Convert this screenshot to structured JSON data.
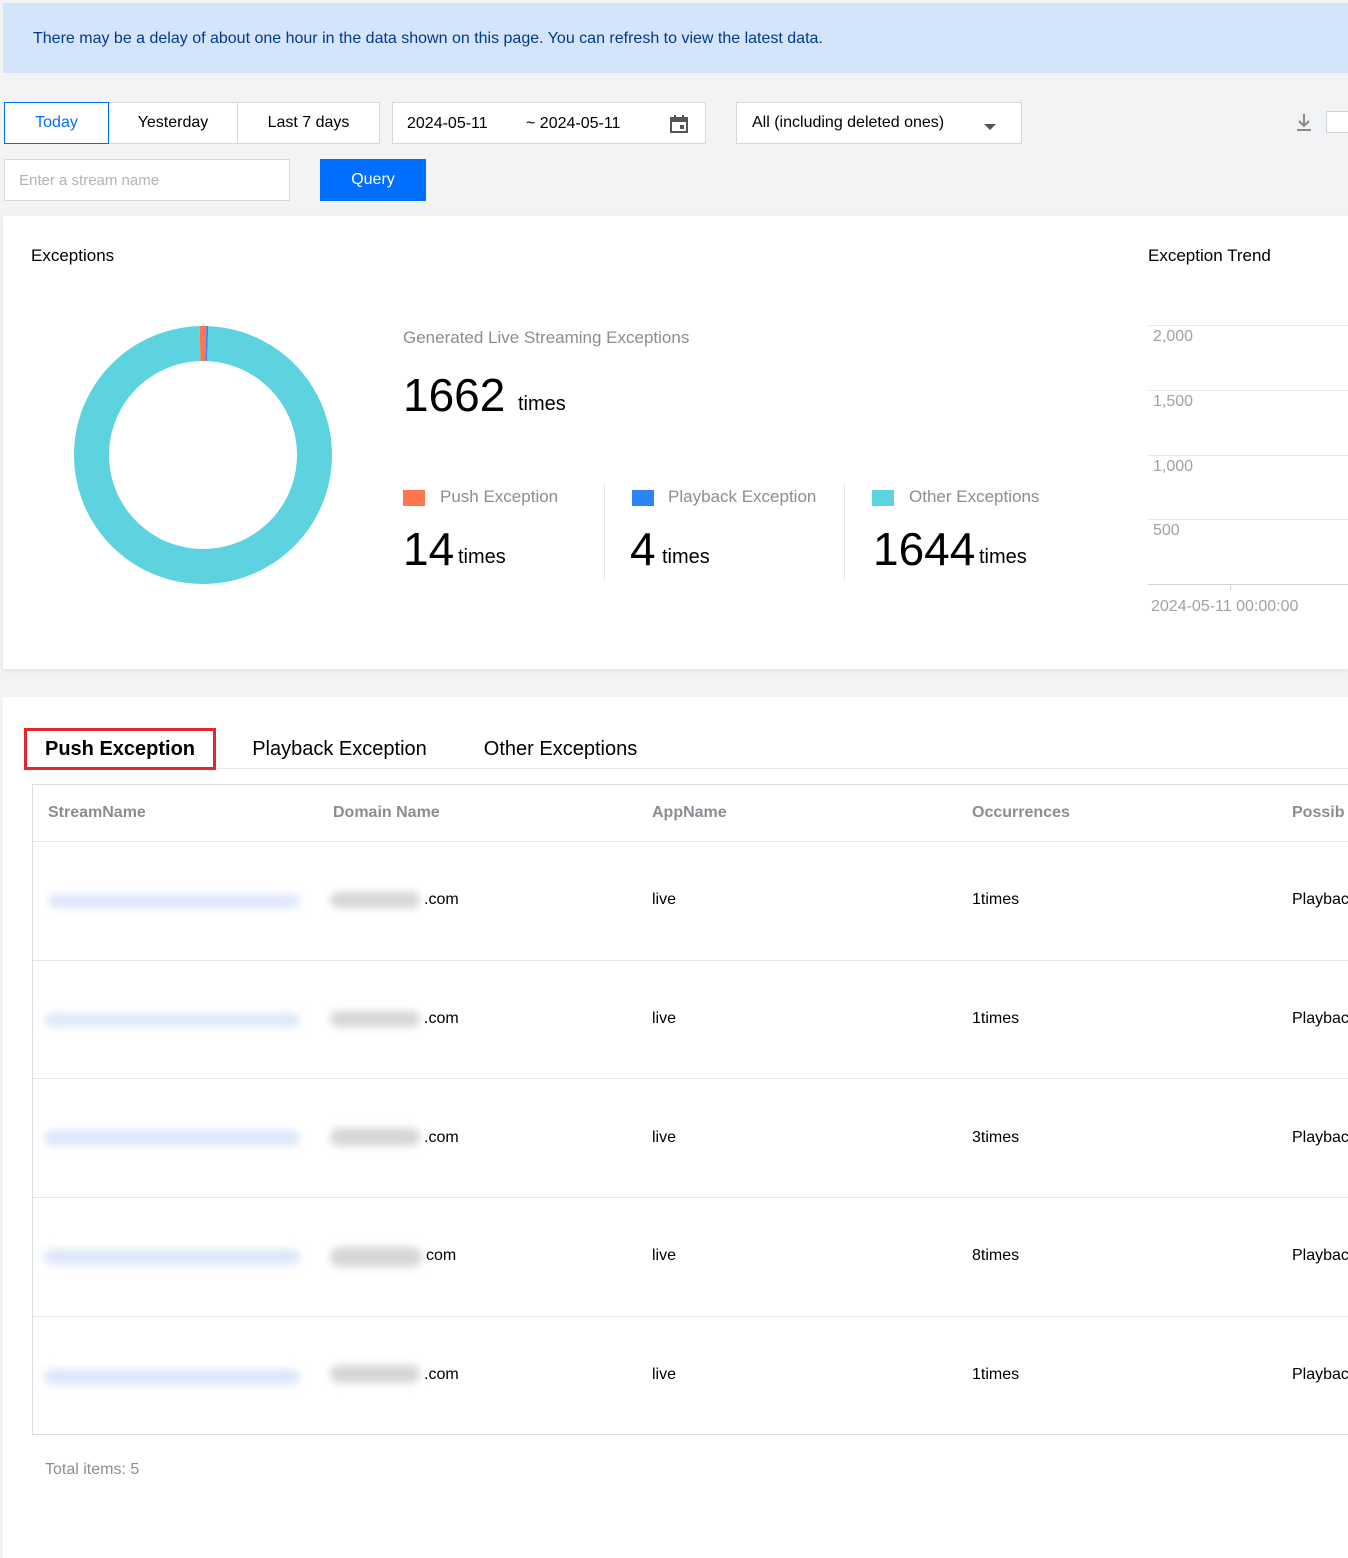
{
  "banner": {
    "text": "There may be a delay of about one hour in the data shown on this page. You can refresh to view the latest data."
  },
  "filters": {
    "ranges": [
      {
        "label": "Today",
        "active": true
      },
      {
        "label": "Yesterday",
        "active": false
      },
      {
        "label": "Last 7 days",
        "active": false
      }
    ],
    "date_start": "2024-05-11",
    "date_end": "~ 2024-05-11",
    "domain_select": "All (including deleted ones)",
    "search_placeholder": "Enter a stream name",
    "query_label": "Query"
  },
  "exceptions": {
    "title": "Exceptions",
    "generated_label": "Generated Live Streaming Exceptions",
    "total": "1662",
    "unit": "times",
    "categories": [
      {
        "name": "Push Exception",
        "count": "14",
        "unit": "times",
        "color": "#ff7550"
      },
      {
        "name": "Playback Exception",
        "count": "4",
        "unit": "times",
        "color": "#2d84f7"
      },
      {
        "name": "Other Exceptions",
        "count": "1644",
        "unit": "times",
        "color": "#5cd3de"
      }
    ]
  },
  "chart_data": {
    "type": "pie",
    "title": "",
    "categories": [
      "Push Exception",
      "Playback Exception",
      "Other Exceptions"
    ],
    "values": [
      14,
      4,
      1644
    ],
    "colors": [
      "#ff7550",
      "#2d84f7",
      "#5cd3de"
    ]
  },
  "trend": {
    "title": "Exception Trend",
    "y_ticks": [
      "2,000",
      "1,500",
      "1,000",
      "500"
    ],
    "x_tick": "2024-05-11 00:00:00"
  },
  "tabs": [
    {
      "label": "Push Exception",
      "active": true
    },
    {
      "label": "Playback Exception",
      "active": false
    },
    {
      "label": "Other Exceptions",
      "active": false
    }
  ],
  "table": {
    "headers": [
      "StreamName",
      "Domain Name",
      "AppName",
      "Occurrences",
      "Possib"
    ],
    "rows": [
      {
        "domain_suffix": ".com",
        "app": "live",
        "occurrences": "1times",
        "reason": "Playbac"
      },
      {
        "domain_suffix": ".com",
        "app": "live",
        "occurrences": "1times",
        "reason": "Playbac"
      },
      {
        "domain_suffix": ".com",
        "app": "live",
        "occurrences": "3times",
        "reason": "Playbac"
      },
      {
        "domain_suffix": "com",
        "app": "live",
        "occurrences": "8times",
        "reason": "Playbac"
      },
      {
        "domain_suffix": ".com",
        "app": "live",
        "occurrences": "1times",
        "reason": "Playbac"
      }
    ],
    "total_label": "Total items:",
    "total_count": "5"
  },
  "icons": {
    "calendar": "calendar-icon",
    "dropdown": "caret-down-icon",
    "download": "download-icon"
  }
}
